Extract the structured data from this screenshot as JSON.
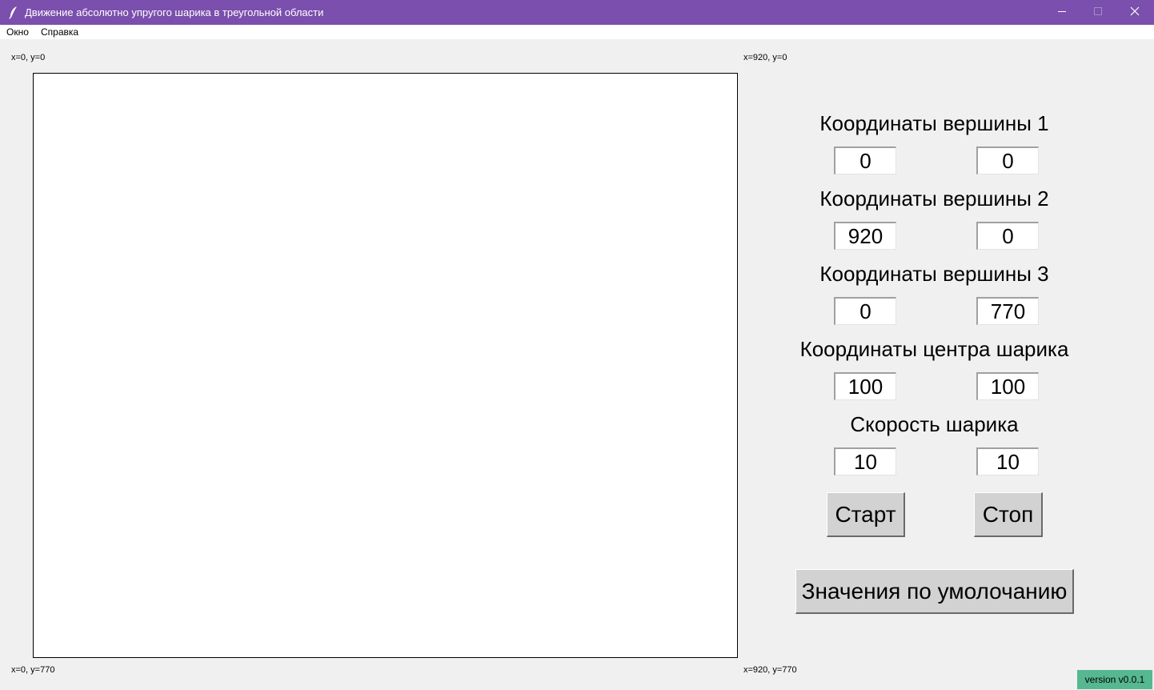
{
  "window": {
    "title": "Движение абсолютно упругого шарика в треугольной области",
    "icon": "feather-icon",
    "controls": [
      "minimize-icon",
      "maximize-icon",
      "close-icon"
    ]
  },
  "menu": {
    "items": [
      {
        "label": "Окно"
      },
      {
        "label": "Справка"
      }
    ]
  },
  "canvas": {
    "corner_top_left": "x=0, y=0",
    "corner_top_right": "x=920, y=0",
    "corner_bottom_left": "x=0, y=770",
    "corner_bottom_right": "x=920, y=770"
  },
  "panel": {
    "vertex1": {
      "label": "Координаты вершины 1",
      "x": "0",
      "y": "0"
    },
    "vertex2": {
      "label": "Координаты вершины 2",
      "x": "920",
      "y": "0"
    },
    "vertex3": {
      "label": "Координаты вершины 3",
      "x": "0",
      "y": "770"
    },
    "ball_center": {
      "label": "Координаты центра шарика",
      "x": "100",
      "y": "100"
    },
    "ball_speed": {
      "label": "Скорость шарика",
      "x": "10",
      "y": "10"
    },
    "start_label": "Старт",
    "stop_label": "Стоп",
    "defaults_label": "Значения по умолочанию"
  },
  "version": "version v0.0.1",
  "colors": {
    "titlebar": "#7b4fad",
    "version_badge": "#56b890",
    "background": "#f0f0f0"
  }
}
